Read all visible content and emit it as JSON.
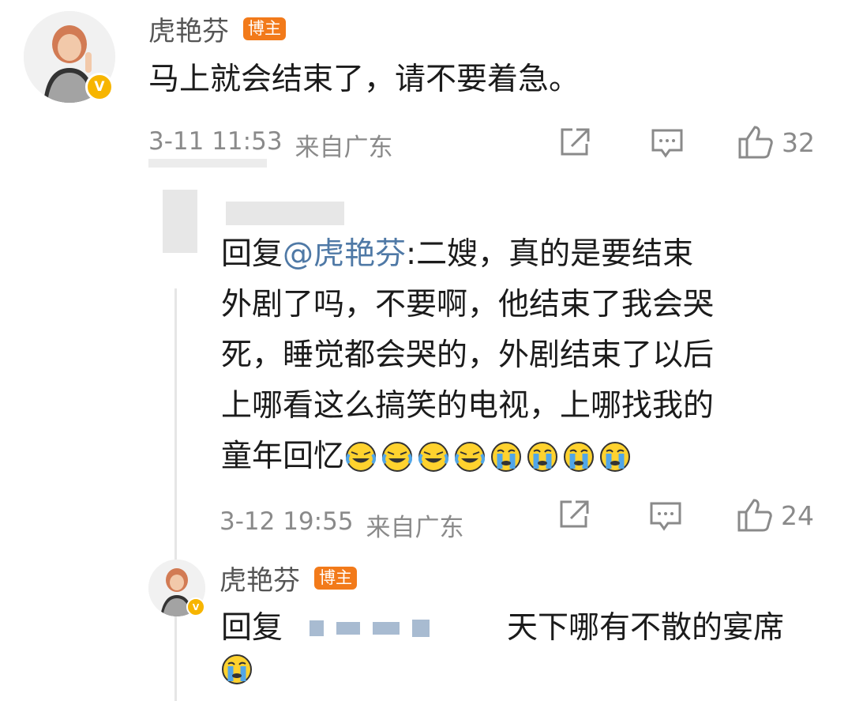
{
  "comment": {
    "author": "虎艳芬",
    "badge": "博主",
    "text": "马上就会结束了，请不要着急。",
    "time": "3-11 11:53",
    "location": "来自广东",
    "likes": "32",
    "icons": [
      "share-icon",
      "comment-icon",
      "like-icon"
    ]
  },
  "reply1": {
    "reply_prefix": "回复",
    "mention": "@虎艳芬",
    "text_line1": ":二嫂，真的是要结束",
    "text_line2": "外剧了吗，不要啊，他结束了我会哭",
    "text_line3": "死，睡觉都会哭的，外剧结束了以后",
    "text_line4": "上哪看这么搞笑的电视，上哪找我的",
    "text_line5": "童年回忆",
    "emojis": [
      "laugh-cry-emoji",
      "laugh-cry-emoji",
      "laugh-cry-emoji",
      "laugh-cry-emoji",
      "crying-emoji",
      "crying-emoji",
      "crying-emoji",
      "crying-emoji"
    ],
    "time": "3-12 19:55",
    "location": "来自广东",
    "likes": "24"
  },
  "reply2": {
    "author": "虎艳芬",
    "badge": "博主",
    "text_start": "回复",
    "text_end": "天下哪有不散的宴席",
    "emojis": [
      "crying-emoji"
    ]
  },
  "colors": {
    "badge": "#f27a1a",
    "verified": "#f7b500",
    "mention": "#4f79a6",
    "meta": "#8a8a8a"
  }
}
